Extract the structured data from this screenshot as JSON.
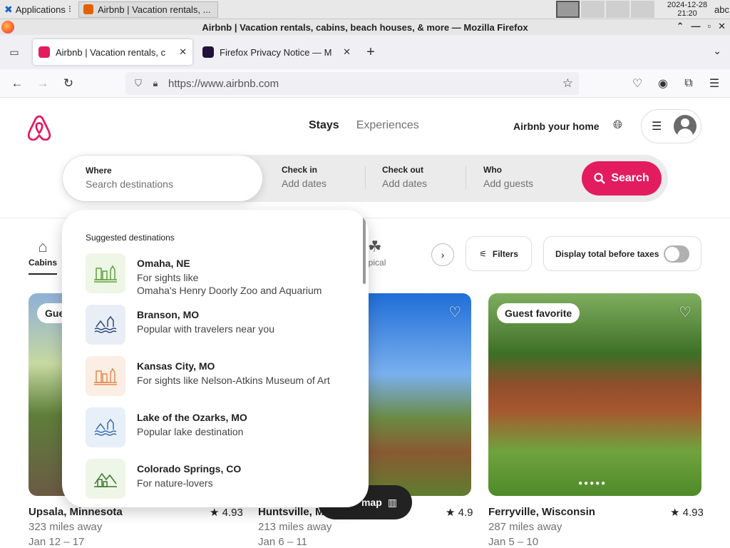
{
  "os": {
    "apps_label": "Applications",
    "task_label": "Airbnb | Vacation rentals, ...",
    "clock_date": "2024-12-28",
    "clock_time": "21:20",
    "kbd": "abc"
  },
  "window": {
    "title": "Airbnb | Vacation rentals, cabins, beach houses, & more — Mozilla Firefox"
  },
  "tabs": [
    {
      "label": "Airbnb | Vacation rentals, c",
      "color": "#e31c5f"
    },
    {
      "label": "Firefox Privacy Notice — M",
      "color": "#20123a"
    }
  ],
  "url": {
    "value": "https://www.airbnb.com"
  },
  "header": {
    "nav_stays": "Stays",
    "nav_experiences": "Experiences",
    "host_link": "Airbnb your home"
  },
  "search": {
    "where_label": "Where",
    "where_placeholder": "Search destinations",
    "checkin_label": "Check in",
    "checkin_value": "Add dates",
    "checkout_label": "Check out",
    "checkout_value": "Add dates",
    "who_label": "Who",
    "who_value": "Add guests",
    "button_label": "Search",
    "accent": "#e31c5f"
  },
  "categories": {
    "first": "Cabins",
    "partial": "opical"
  },
  "filters": {
    "filters_label": "Filters",
    "taxes_label": "Display total before taxes"
  },
  "suggestions": {
    "title": "Suggested destinations",
    "items": [
      {
        "name": "Omaha, NE",
        "desc1": "For sights like",
        "desc2": "Omaha's Henry Doorly Zoo and Aquarium",
        "bg": "#eef6e6",
        "fg": "#5ea13a"
      },
      {
        "name": "Branson, MO",
        "desc1": "Popular with travelers near you",
        "desc2": "",
        "bg": "#e9eef6",
        "fg": "#2b4a7a"
      },
      {
        "name": "Kansas City, MO",
        "desc1": "For sights like Nelson-Atkins Museum of Art",
        "desc2": "",
        "bg": "#fbeee4",
        "fg": "#e08b4d"
      },
      {
        "name": "Lake of the Ozarks, MO",
        "desc1": "Popular lake destination",
        "desc2": "",
        "bg": "#e7eff8",
        "fg": "#3a6fb0"
      },
      {
        "name": "Colorado Springs, CO",
        "desc1": "For nature-lovers",
        "desc2": "",
        "bg": "#eef6e8",
        "fg": "#3a7a2a"
      }
    ]
  },
  "listings": [
    {
      "title": "Upsala, Minnesota",
      "rating": "4.93",
      "distance": "323 miles away",
      "dates": "Jan 12 – 17",
      "badge": "Gue"
    },
    {
      "title": "Huntsville, M",
      "rating": "4.9",
      "distance": "213 miles away",
      "dates": "Jan 6 – 11",
      "badge": ""
    },
    {
      "title": "Ferryville, Wisconsin",
      "rating": "4.93",
      "distance": "287 miles away",
      "dates": "Jan 5 – 10",
      "badge": "Guest favorite"
    }
  ],
  "map_button": "map"
}
